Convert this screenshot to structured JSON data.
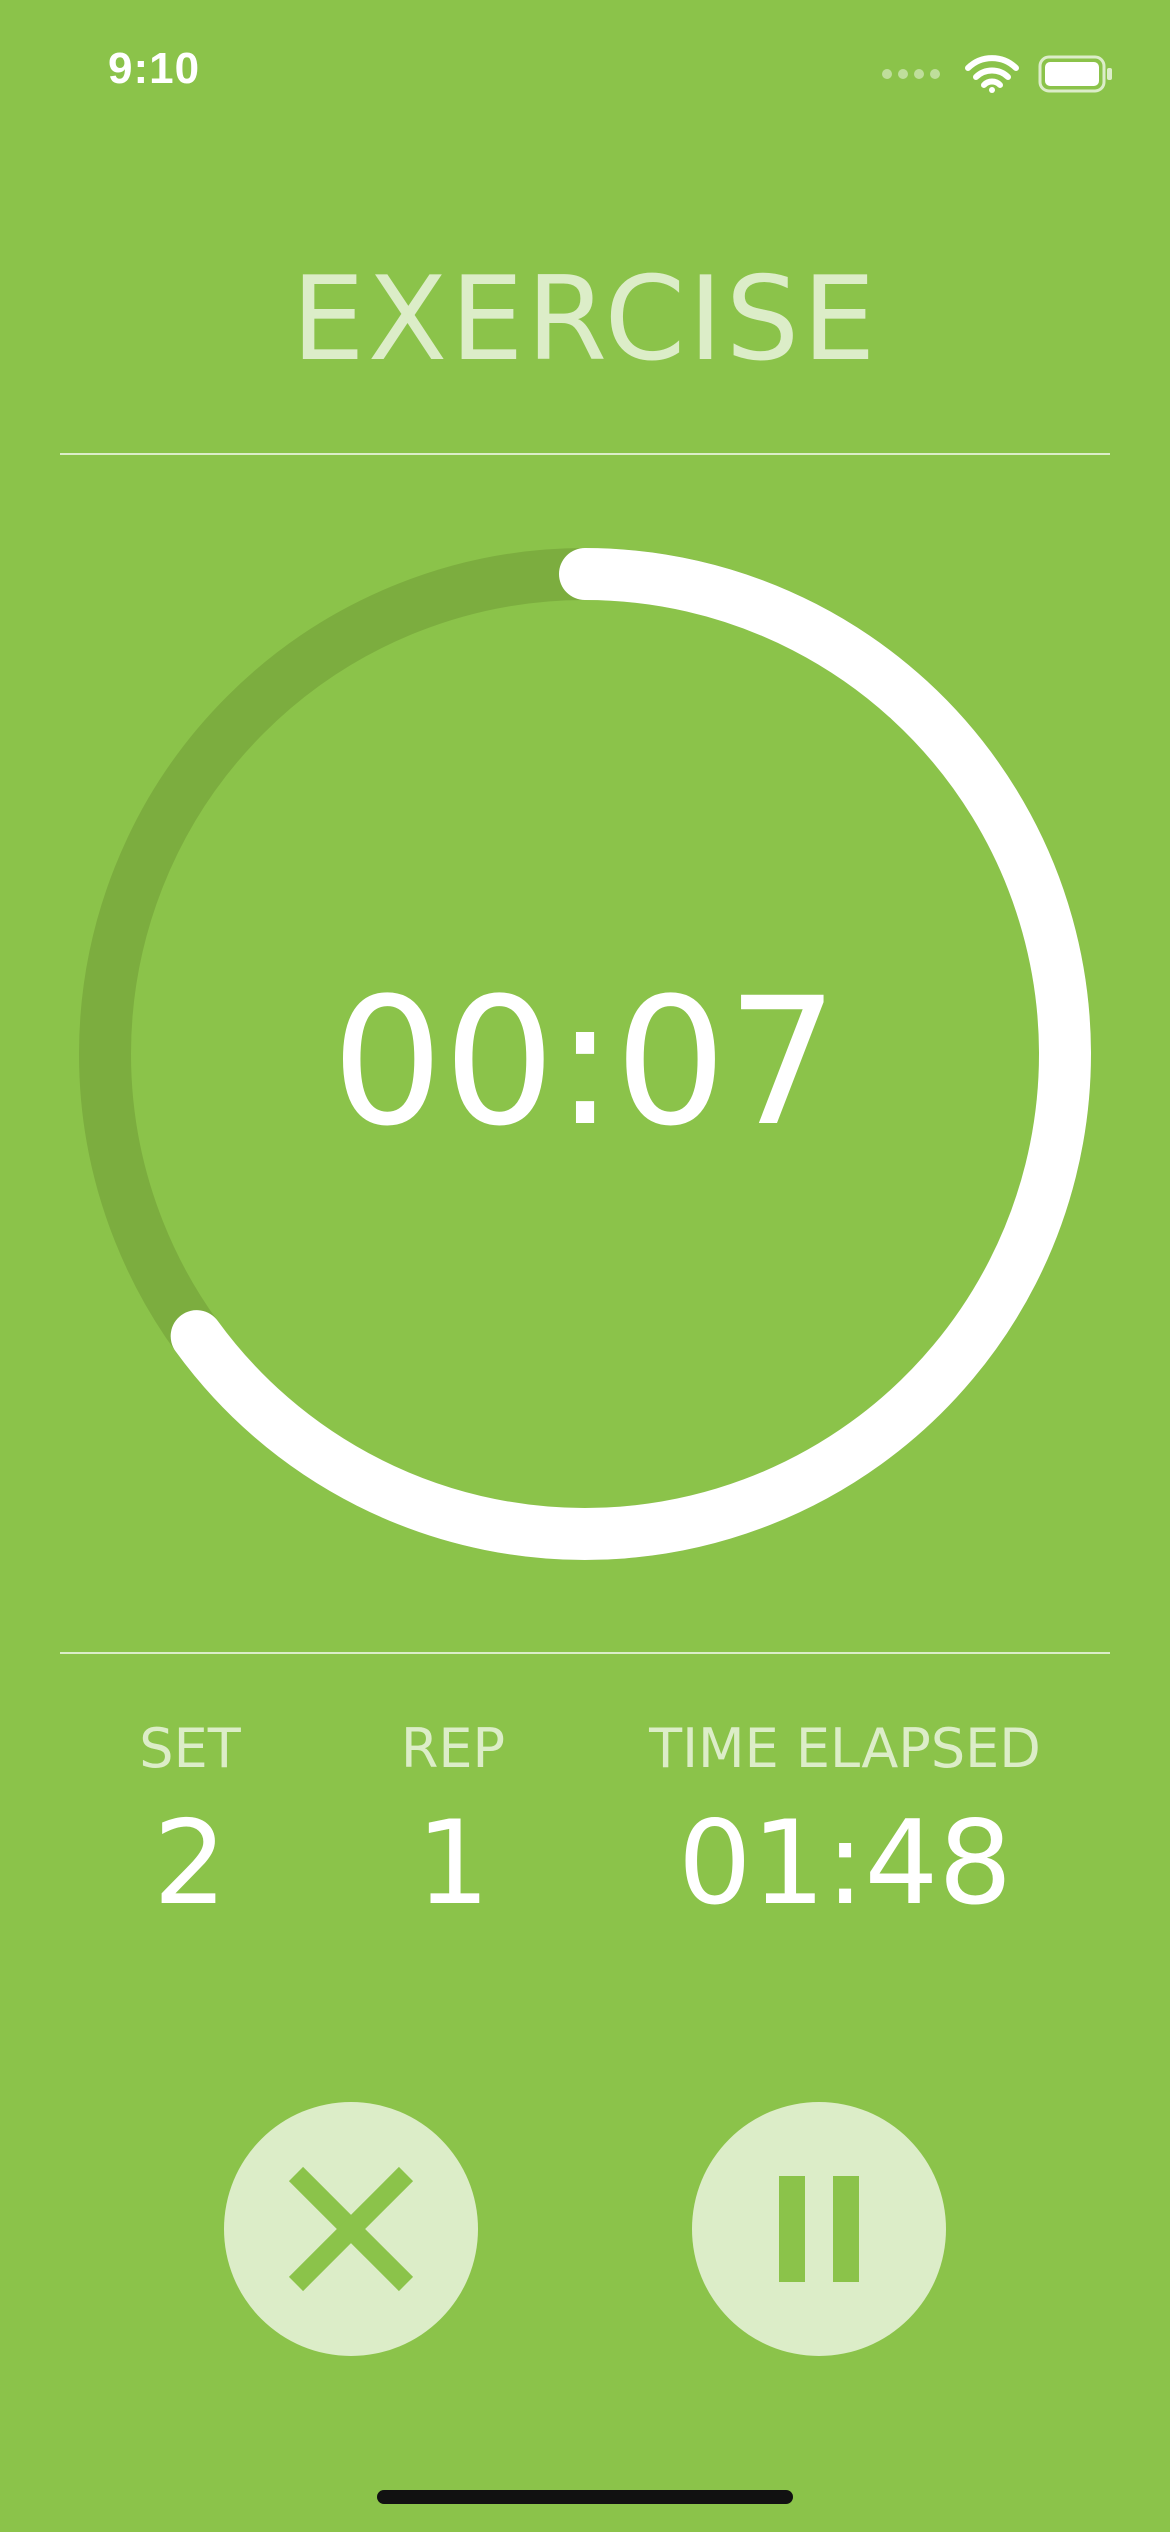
{
  "status_bar": {
    "time": "9:10",
    "icons": [
      "signal-icon",
      "wifi-icon",
      "battery-icon"
    ]
  },
  "header": {
    "title": "EXERCISE"
  },
  "timer": {
    "display": "00:07",
    "progress_fraction": 0.65
  },
  "stats": {
    "set_label": "SET",
    "set_value": "2",
    "rep_label": "REP",
    "rep_value": "1",
    "elapsed_label": "TIME ELAPSED",
    "elapsed_value": "01:48"
  },
  "controls": {
    "cancel_icon": "close-icon",
    "pause_icon": "pause-icon"
  },
  "colors": {
    "background": "#8bc34a",
    "track": "#7cad3f",
    "progress": "#ffffff",
    "label": "#dcedc8",
    "button_fill": "#dcedc8",
    "button_icon": "#8bc34a"
  }
}
